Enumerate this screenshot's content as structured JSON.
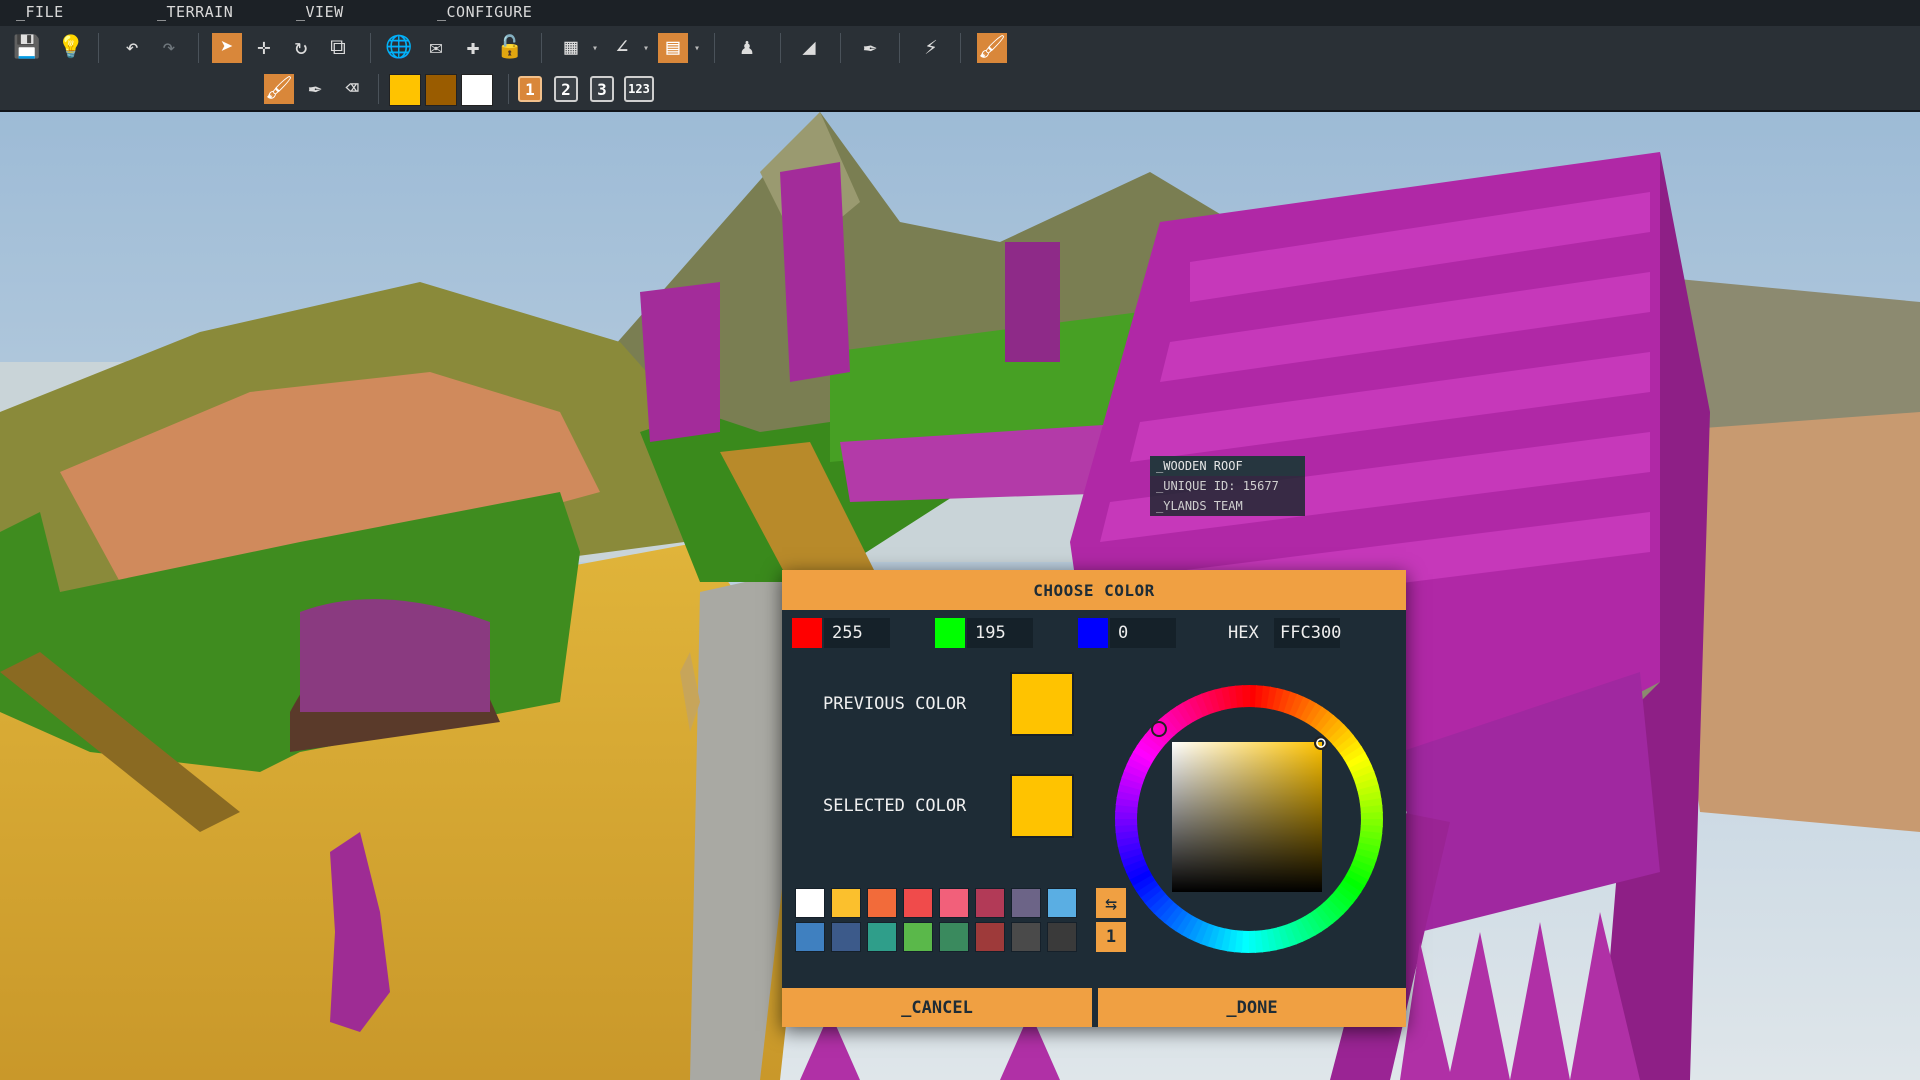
{
  "menu": {
    "file": "_FILE",
    "terrain": "_TERRAIN",
    "view": "_VIEW",
    "configure": "_CONFIGURE"
  },
  "toolbar": {
    "row1": [
      "save-icon",
      "lightbulb-icon",
      "undo-icon",
      "redo-icon",
      "select-arrow-icon",
      "move-icon",
      "rotate-icon",
      "scale-icon",
      "globe-icon",
      "envelope-icon",
      "snap-move-icon",
      "lock-icon",
      "grid-icon",
      "angle-icon",
      "ruler-icon",
      "camera-person-icon",
      "terrain-ramp-icon",
      "eyedropper-icon",
      "lightning-icon",
      "paint-brush-icon"
    ],
    "row2": [
      "paint-brush-icon",
      "eyedropper-icon",
      "eraser-icon"
    ],
    "swatches": [
      "#ffc300",
      "#9a5c00",
      "#ffffff"
    ],
    "layer_buttons": [
      "1",
      "2",
      "3",
      "123"
    ],
    "active_layer": "1"
  },
  "tooltip": {
    "title": "_WOODEN ROOF",
    "unique_id": "_UNIQUE ID: 15677",
    "team": "_YLANDS TEAM"
  },
  "dialog": {
    "title": "CHOOSE COLOR",
    "red": {
      "value": "255",
      "color": "#ff0000"
    },
    "green": {
      "value": "195",
      "color": "#00ff00"
    },
    "blue": {
      "value": "0",
      "color": "#0000ff"
    },
    "hex_label": "HEX",
    "hex_value": "FFC300",
    "previous_color_label": "PREVIOUS COLOR",
    "previous_color": "#ffc300",
    "selected_color_label": "SELECTED COLOR",
    "selected_color": "#ffc300",
    "palette_row1": [
      "#ffffff",
      "#fbc02d",
      "#f26b3a",
      "#f04b4b",
      "#f2607a",
      "#b23a57",
      "#6c6487",
      "#5aaee3"
    ],
    "palette_row2": [
      "#3f80c0",
      "#3c5a8a",
      "#2f9e8a",
      "#5ab84a",
      "#3a8a5e",
      "#9e3a3a",
      "#4a4a4a",
      "#3a3a3a"
    ],
    "page_number": "1",
    "cancel_label": "_CANCEL",
    "done_label": "_DONE"
  }
}
